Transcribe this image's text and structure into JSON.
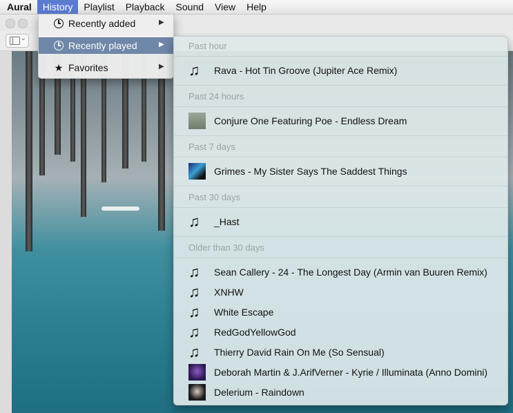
{
  "menubar": {
    "app": "Aural",
    "items": [
      "History",
      "Playlist",
      "Playback",
      "Sound",
      "View",
      "Help"
    ]
  },
  "history_menu": {
    "items": [
      {
        "label": "Recently added",
        "icon": "clock-plus-icon"
      },
      {
        "label": "Recently played",
        "icon": "clock-icon"
      },
      {
        "label": "Favorites",
        "icon": "star-icon"
      }
    ]
  },
  "recently_played": {
    "sections": [
      {
        "heading": "Past hour",
        "tracks": [
          {
            "title": "Rava - Hot Tin Groove (Jupiter Ace Remix)",
            "icon": "music-note-icon"
          }
        ]
      },
      {
        "heading": "Past 24 hours",
        "tracks": [
          {
            "title": "Conjure One Featuring Poe - Endless Dream",
            "icon": "album-art"
          }
        ]
      },
      {
        "heading": "Past 7 days",
        "tracks": [
          {
            "title": "Grimes - My Sister Says The Saddest Things",
            "icon": "album-art"
          }
        ]
      },
      {
        "heading": "Past 30 days",
        "tracks": [
          {
            "title": "_Hast",
            "icon": "music-note-icon"
          }
        ]
      },
      {
        "heading": "Older than 30 days",
        "tracks": [
          {
            "title": "Sean Callery - 24 - The Longest Day (Armin van Buuren Remix)",
            "icon": "music-note-icon"
          },
          {
            "title": "XNHW",
            "icon": "music-note-icon"
          },
          {
            "title": "White Escape",
            "icon": "music-note-icon"
          },
          {
            "title": "RedGodYellowGod",
            "icon": "music-note-icon"
          },
          {
            "title": "Thierry David  Rain On Me (So Sensual)",
            "icon": "music-note-icon"
          },
          {
            "title": "Deborah Martin & J.ArifVerner - Kyrie / Illuminata  (Anno Domini)",
            "icon": "album-art"
          },
          {
            "title": "Delerium - Raindown",
            "icon": "album-art"
          }
        ]
      }
    ]
  }
}
